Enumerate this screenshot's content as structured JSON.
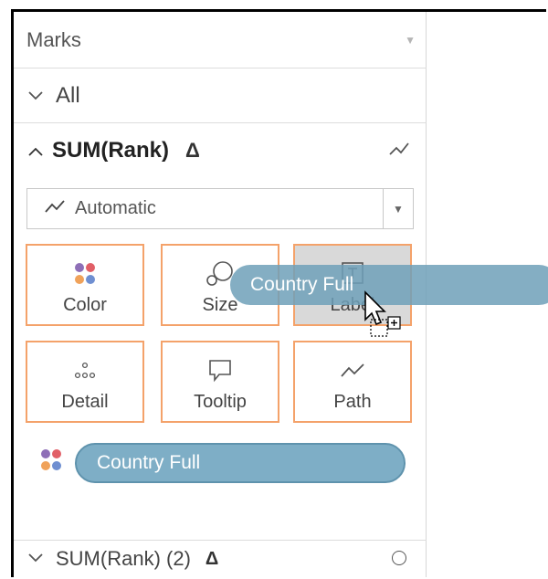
{
  "marks_panel": {
    "title": "Marks",
    "all_label": "All",
    "sum_label": "SUM(Rank)",
    "delta": "Δ",
    "mark_type": "Automatic",
    "tiles": [
      {
        "label": "Color",
        "icon": "color-dots-icon"
      },
      {
        "label": "Size",
        "icon": "size-icon"
      },
      {
        "label": "Label",
        "icon": "label-icon"
      },
      {
        "label": "Detail",
        "icon": "detail-icon"
      },
      {
        "label": "Tooltip",
        "icon": "tooltip-icon"
      },
      {
        "label": "Path",
        "icon": "path-icon"
      }
    ],
    "color_pill": "Country Full",
    "dragged_pill": "Country Full",
    "second_measure_label": "SUM(Rank) (2)",
    "second_delta": "Δ"
  },
  "colors": {
    "pill": "#7eaec6",
    "tile_border": "#f4a26a",
    "dot_purple": "#8e6fb7",
    "dot_red": "#e15f67",
    "dot_orange": "#f0a25a",
    "dot_blue": "#6f8fd1"
  }
}
